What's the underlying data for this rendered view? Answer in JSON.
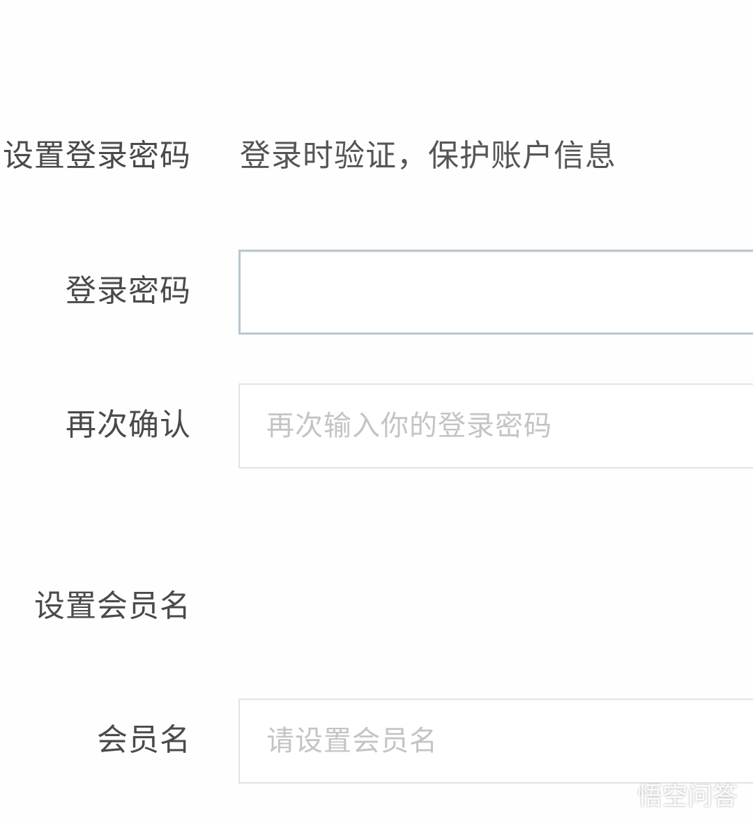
{
  "password_section": {
    "title": "设置登录密码",
    "hint": "登录时验证，保护账户信息"
  },
  "password_field": {
    "label": "登录密码",
    "value": "",
    "placeholder": ""
  },
  "confirm_field": {
    "label": "再次确认",
    "value": "",
    "placeholder": "再次输入你的登录密码"
  },
  "member_section": {
    "title": "设置会员名"
  },
  "member_field": {
    "label": "会员名",
    "value": "",
    "placeholder": "请设置会员名"
  },
  "watermark": {
    "text": "悟空问答",
    "icon": "chat-bubbles-icon"
  }
}
